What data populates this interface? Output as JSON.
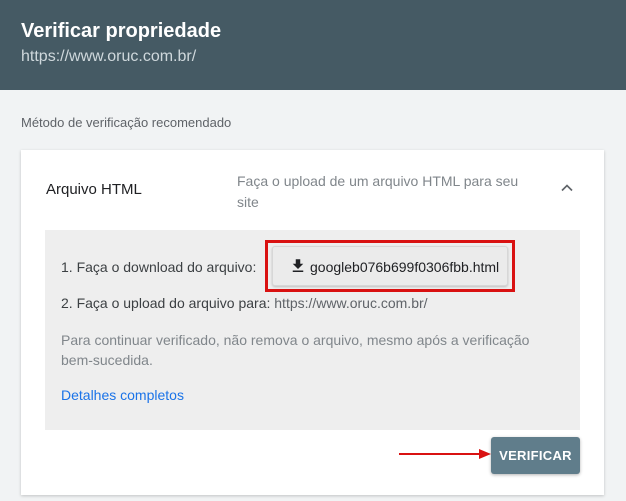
{
  "header": {
    "title": "Verificar propriedade",
    "url": "https://www.oruc.com.br/"
  },
  "section_label": "Método de verificação recomendado",
  "card": {
    "title": "Arquivo HTML",
    "description": "Faça o upload de um arquivo HTML para seu site",
    "collapse_icon": "chevron-up-icon",
    "step1_label": "1. Faça o download do arquivo:",
    "download_button": {
      "icon": "download-icon",
      "label": "googleb076b699f0306fbb.html"
    },
    "step2_label": "2. Faça o upload do arquivo para:",
    "step2_url": "https://www.oruc.com.br/",
    "note": "Para continuar verificado, não remova o arquivo, mesmo após a verificação bem-sucedida.",
    "details_link": "Detalhes completos",
    "verify_button": "VERIFICAR"
  },
  "colors": {
    "header_bg": "#455a64",
    "highlight": "#d91111",
    "link": "#1a73e8",
    "verify_button_bg": "#607d8b"
  }
}
